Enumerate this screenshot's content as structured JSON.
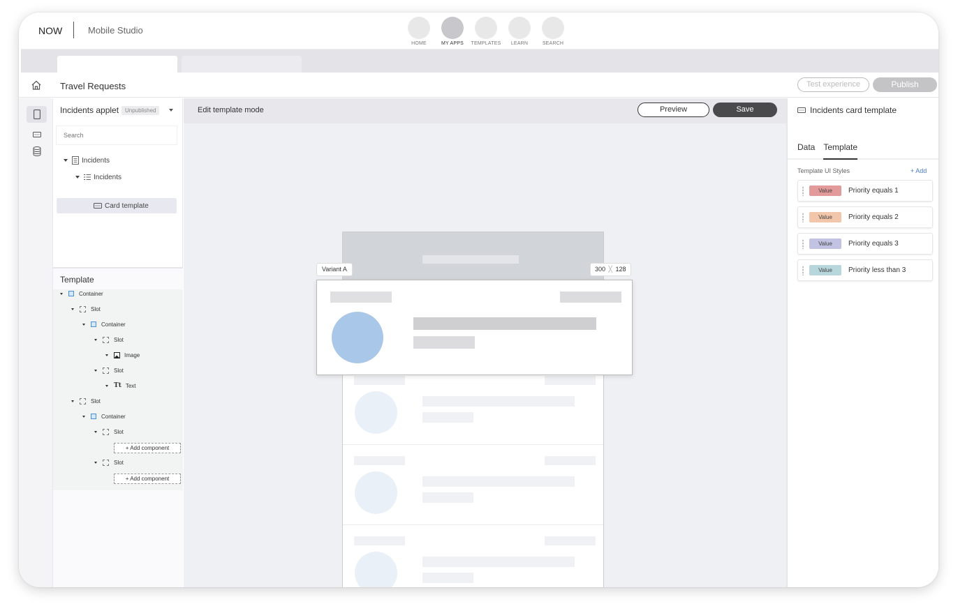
{
  "topbar": {
    "brand": "NOW",
    "app_name": "Mobile Studio",
    "nav": [
      {
        "label": "HOME"
      },
      {
        "label": "MY APPS"
      },
      {
        "label": "TEMPLATES"
      },
      {
        "label": "LEARN"
      },
      {
        "label": "SEARCH"
      }
    ]
  },
  "titlebar": {
    "title": "Travel Requests",
    "test_label": "Test experience",
    "publish_label": "Publish"
  },
  "left_panel": {
    "applet_name": "Incidents applet",
    "status_badge": "Unpublished",
    "search_placeholder": "Search",
    "tree": [
      {
        "label": "Incidents"
      },
      {
        "label": "Incidents"
      },
      {
        "label": "Card template"
      }
    ],
    "template_title": "Template",
    "template_tree": [
      {
        "label": "Container"
      },
      {
        "label": "Slot"
      },
      {
        "label": "Container"
      },
      {
        "label": "Slot"
      },
      {
        "label": "Image"
      },
      {
        "label": "Slot"
      },
      {
        "label": "Text"
      },
      {
        "label": "Slot"
      },
      {
        "label": "Container"
      },
      {
        "label": "Slot"
      },
      {
        "label": "Slot"
      }
    ],
    "add_component_label": "+ Add component"
  },
  "canvas": {
    "mode_label": "Edit template mode",
    "preview_label": "Preview",
    "save_label": "Save",
    "variant_label": "Variant A",
    "size_width": "300",
    "size_height": "128"
  },
  "right_panel": {
    "title": "Incidents card template",
    "tabs": [
      {
        "label": "Data"
      },
      {
        "label": "Template"
      }
    ],
    "section_title": "Template UI Styles",
    "add_label": "+ Add",
    "styles": [
      {
        "pill": "Value",
        "label": "Priority equals 1",
        "color": "#e39a9a"
      },
      {
        "pill": "Value",
        "label": "Priority equals 2",
        "color": "#f1c6ab"
      },
      {
        "pill": "Value",
        "label": "Priority equals 3",
        "color": "#c2c2e2"
      },
      {
        "pill": "Value",
        "label": "Priority less than 3",
        "color": "#b7d7dc"
      }
    ]
  }
}
